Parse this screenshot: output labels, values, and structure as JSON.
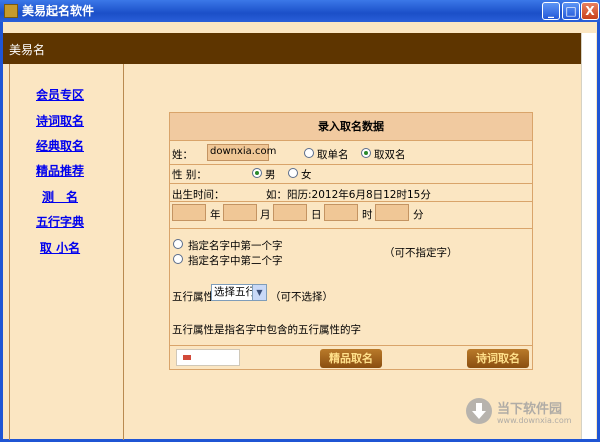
{
  "window": {
    "title": "美易起名软件",
    "buttons": {
      "min": "_",
      "max": "□",
      "close": "X"
    }
  },
  "header": {
    "title": "美易名"
  },
  "sidebar": {
    "items": [
      {
        "label": "会员专区"
      },
      {
        "label": "诗词取名"
      },
      {
        "label": "经典取名"
      },
      {
        "label": "精品推荐"
      },
      {
        "label": "测　名"
      },
      {
        "label": "五行字典"
      },
      {
        "label": "取 小名"
      }
    ]
  },
  "form": {
    "heading": "录入取名数据",
    "surname_label": "姓：",
    "surname_value": "downxia.com",
    "single_name_label": "取单名",
    "double_name_label": "取双名",
    "gender_label": "性 别：",
    "male_label": "男",
    "female_label": "女",
    "birth_label": "出生时间：",
    "birth_example": "如：阳历:2012年6月8日12时15分",
    "date_units": [
      "年",
      "月",
      "日",
      "时",
      "分"
    ],
    "option_first": "指定名字中第一个字",
    "option_second": "指定名字中第二个字",
    "optional_note": "（可不指定字）",
    "wuxing_label": "五行属性:",
    "wuxing_select": "选择五行",
    "wuxing_note": "（可不选择）",
    "wuxing_desc": "五行属性是指名字中包含的五行属性的字",
    "btn_jingpin": "精品取名",
    "btn_shici": "诗词取名"
  },
  "watermark": {
    "brand": "当下软件园",
    "url": "www.downxia.com"
  },
  "colors": {
    "header_bg": "#5e3500",
    "page_bg": "#fbe6c2",
    "link": "#0000ee",
    "button_bg": "#9b5e1b"
  }
}
